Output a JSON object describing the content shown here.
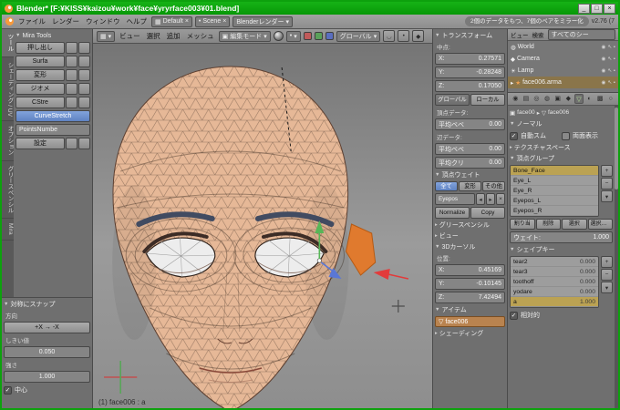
{
  "colors": {
    "titlebar_green": "#0da10d",
    "face_skin": "#e6b897",
    "selection_orange": "#e07a2e",
    "active_blue": "#5f82c2",
    "highlight_tan": "#bba253"
  },
  "icons": {
    "collapse": "▼",
    "expand": "▸",
    "dropdown": "▾",
    "check": "✓",
    "close": "×",
    "plus": "+",
    "minus": "−",
    "left": "◂",
    "right": "▸",
    "screen": "▦",
    "cube": "▣",
    "mesh": "▽",
    "world": "◍",
    "camera": "◆",
    "lamp": "☀",
    "armature": "★",
    "eye": "◉",
    "pointer": "↖",
    "render": "▪",
    "dot": "•",
    "magnet": "◡"
  },
  "window": {
    "title": "Blender* [F:¥KISS¥kaizou¥work¥face¥yryrface003¥01.blend]",
    "minimize": "_",
    "maximize": "□",
    "close": "×"
  },
  "menubar": {
    "menus": [
      "ファイル",
      "レンダー",
      "ウィンドウ",
      "ヘルプ"
    ],
    "layout": "Default",
    "scene": "Scene",
    "engine": "Blenderレンダー",
    "status": "2個のデータをもつ、7個のペアをミラー化",
    "version": "v2.76 (7"
  },
  "toolshelf": {
    "tabs": [
      "ツール",
      "シェーディング / UV",
      "オプション",
      "グリースペンシル",
      "Mira"
    ]
  },
  "mira": {
    "title": "Mira Tools",
    "rows": [
      "押し出し",
      "Surfa",
      "変形",
      "ジオメ",
      "CStre"
    ],
    "curve_stretch": "CurveStretch",
    "points": "PointsNumbe",
    "settings": "設定"
  },
  "snap": {
    "title": "対称にスナップ",
    "direction_label": "方向",
    "direction": "+X → -X",
    "threshold_label": "しきい値",
    "threshold": "0.050",
    "strength_label": "強さ",
    "strength": "1.000",
    "center": "中心"
  },
  "viewport": {
    "menus": [
      "ビュー",
      "選択",
      "追加",
      "メッシュ"
    ],
    "mode": "編集モード",
    "orientation": "グローバル",
    "footer": "(1) face006 : a"
  },
  "npanel": {
    "transform_title": "トランスフォーム",
    "median_label": "中点:",
    "median": [
      {
        "label": "X:",
        "value": "0.27571"
      },
      {
        "label": "Y:",
        "value": "-0.28248"
      },
      {
        "label": "Z:",
        "value": "0.17050"
      }
    ],
    "global_btn": "グローバル",
    "local_btn": "ローカル",
    "vertex_data_label": "頂点データ:",
    "vertex_bevel": {
      "label": "平均ベベ",
      "value": "0.00"
    },
    "edge_data_label": "辺データ:",
    "edge_bevel": {
      "label": "平均ベベ",
      "value": "0.00"
    },
    "edge_crease": {
      "label": "平均クリ",
      "value": "0.00"
    },
    "weights_title": "頂点ウェイト",
    "weight_tabs": [
      "全て",
      "変形",
      "その他"
    ],
    "weight_group": "Eyepos",
    "normalize_btn": "Normalize",
    "copy_btn": "Copy",
    "gp_title": "グリースペンシル",
    "view_title": "ビュー",
    "cursor_title": "3Dカーソル",
    "cursor_label": "位置:",
    "cursor": [
      {
        "label": "X:",
        "value": "0.45169"
      },
      {
        "label": "Y:",
        "value": "-0.10145"
      },
      {
        "label": "Z:",
        "value": "7.42494"
      }
    ],
    "item_title": "アイテム",
    "item_name": "face006",
    "shading_title": "シェーディング"
  },
  "outliner": {
    "view_menu": "ビュー",
    "search_menu": "検索",
    "filter": "すべてのシー",
    "items": [
      {
        "name": "World"
      },
      {
        "name": "Camera"
      },
      {
        "name": "Lamp"
      },
      {
        "name": "face006.arma"
      }
    ]
  },
  "props": {
    "tabs": [
      {
        "name": "render",
        "glyph": "◉"
      },
      {
        "name": "render-layers",
        "glyph": "▤"
      },
      {
        "name": "scene",
        "glyph": "◎"
      },
      {
        "name": "world",
        "glyph": "◍"
      },
      {
        "name": "object",
        "glyph": "▣"
      },
      {
        "name": "modifiers",
        "glyph": "◆"
      },
      {
        "name": "data",
        "glyph": "▽"
      },
      {
        "name": "material",
        "glyph": "◐"
      },
      {
        "name": "texture",
        "glyph": "▩"
      },
      {
        "name": "physics",
        "glyph": "○"
      }
    ],
    "breadcrumb_object": "face00",
    "breadcrumb_data": "face006",
    "normals_title": "ノーマル",
    "auto_smooth": "自動スム",
    "double_sided": "両面表示",
    "texspace_title": "テクスチャスペース",
    "vgroups_title": "頂点グループ",
    "vgroups": [
      "Bone_Face",
      "Eye_L",
      "Eye_R",
      "Eyepos_L",
      "Eyepos_R"
    ],
    "assign_btn": "割り当",
    "remove_btn": "削除",
    "select_btn": "選択",
    "deselect_btn": "選択解除",
    "weight_label": "ウェイト:",
    "weight_value": "1.000",
    "shapekeys_title": "シェイプキー",
    "shapekeys": [
      {
        "name": "tear2",
        "value": "0.000"
      },
      {
        "name": "tear3",
        "value": "0.000"
      },
      {
        "name": "toothoff",
        "value": "0.000"
      },
      {
        "name": "yodare",
        "value": "0.000"
      },
      {
        "name": "a",
        "value": "1.000"
      }
    ],
    "relative": "相対的"
  }
}
